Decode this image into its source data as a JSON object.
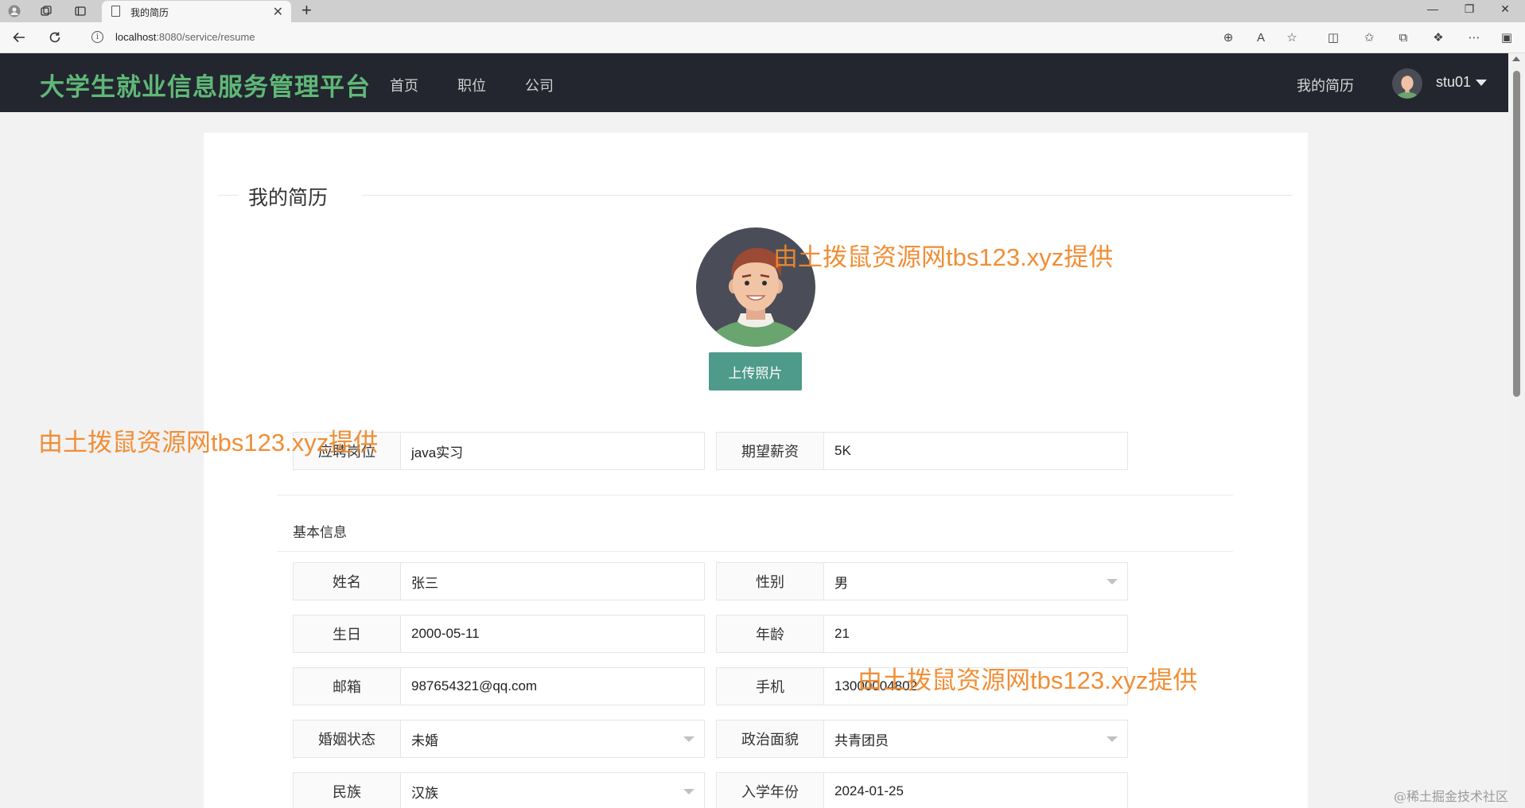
{
  "browser": {
    "tab_title": "我的简历",
    "tab_close": "✕",
    "new_tab": "+",
    "url_host": "localhost",
    "url_rest": ":8080/service/resume",
    "info_glyph": "i"
  },
  "header": {
    "logo": "大学生就业信息服务管理平台",
    "nav": [
      "首页",
      "职位",
      "公司"
    ],
    "my_resume": "我的简历",
    "username": "stu01"
  },
  "page": {
    "section_heading": "我的简历",
    "upload_label": "上传照片",
    "basic_info_title": "基本信息"
  },
  "job": {
    "position_label": "应聘岗位",
    "position_value": "java实习",
    "salary_label": "期望薪资",
    "salary_value": "5K"
  },
  "basic": {
    "name_label": "姓名",
    "name_value": "张三",
    "gender_label": "性别",
    "gender_value": "男",
    "birthday_label": "生日",
    "birthday_value": "2000-05-11",
    "age_label": "年龄",
    "age_value": "21",
    "email_label": "邮箱",
    "email_value": "987654321@qq.com",
    "phone_label": "手机",
    "phone_value": "13000004802",
    "marital_label": "婚姻状态",
    "marital_value": "未婚",
    "political_label": "政治面貌",
    "political_value": "共青团员",
    "ethnicity_label": "民族",
    "ethnicity_value": "汉族",
    "enroll_label": "入学年份",
    "enroll_value": "2024-01-25"
  },
  "watermarks": [
    "由土拨鼠资源网tbs123.xyz提供",
    "由土拨鼠资源网tbs123.xyz提供",
    "由土拨鼠资源网tbs123.xyz提供"
  ],
  "credit": "@稀土掘金技术社区",
  "colors": {
    "header_bg": "#23262e",
    "logo_green": "#5fb878",
    "upload_button": "#4e9a8b",
    "watermark_orange": "#f0892c"
  }
}
